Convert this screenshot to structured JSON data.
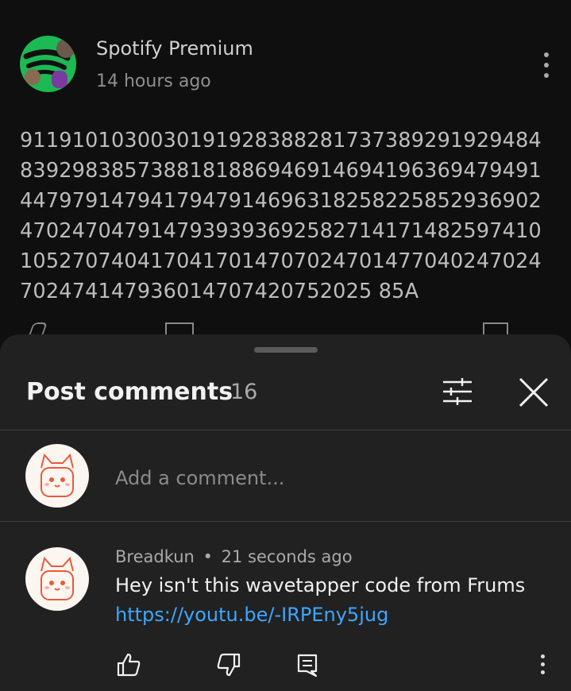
{
  "post": {
    "channel_name": "Spotify Premium",
    "time": "14 hours ago",
    "text": "91191010300301919283882817373892919294848392983857388181886946914694196369479491447979147941794791469631825822585293690247024704791479393936925827141714825974101052707404170417014707024701477040247024702474147936014707420752025 85A"
  },
  "sheet": {
    "title": "Post comments",
    "count": "16",
    "add_placeholder": "Add a comment..."
  },
  "comment": {
    "author": "Breadkun",
    "time": "21 seconds ago",
    "separator": "•",
    "text": "Hey isn't this wavetapper code from Frums",
    "link": "https://youtu.be/-IRPEny5jug"
  },
  "icons": {
    "post_menu": "more-vert-icon",
    "filter": "tune-icon",
    "close": "close-icon",
    "like": "thumb-up-icon",
    "dislike": "thumb-down-icon",
    "reply": "comment-icon",
    "comment_menu": "more-vert-icon"
  },
  "colors": {
    "background": "#0f0f0f",
    "sheet": "#212121",
    "link": "#3ea6ff",
    "spotify_green": "#1db954"
  }
}
